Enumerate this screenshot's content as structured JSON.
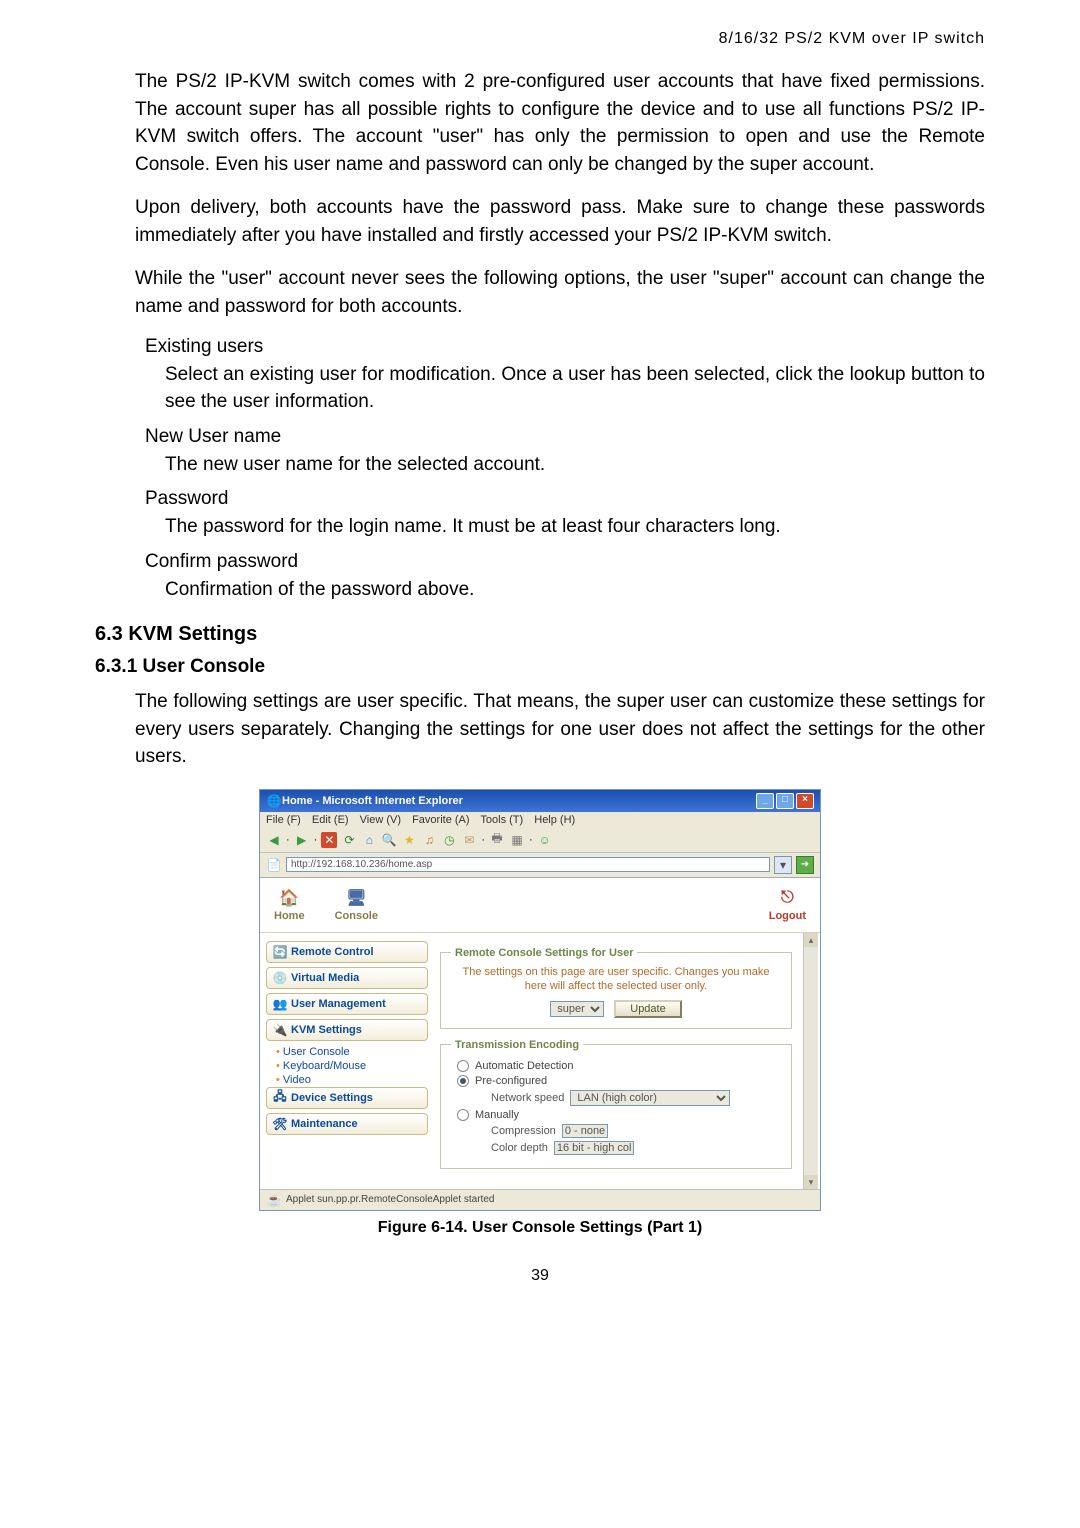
{
  "header": "8/16/32 PS/2 KVM over IP switch",
  "para1": "The PS/2 IP-KVM switch comes with 2 pre-configured user accounts that have fixed permissions. The account super has all possible rights to configure the device and to use all functions PS/2 IP-KVM switch offers. The account \"user\" has only the permission to open and use the Remote Console. Even his user name and password can only be changed by the super account.",
  "para2": "Upon delivery, both accounts have the password pass. Make sure to change these passwords immediately after you have installed and firstly accessed your PS/2 IP-KVM switch.",
  "para3": "While the \"user\" account never sees the following options, the user \"super\" account can change the name and password for both accounts.",
  "terms": {
    "t1": "Existing users",
    "d1": "Select an existing user for modification. Once a user has been selected, click the lookup button to see the user information.",
    "t2": "New User name",
    "d2": "The new user name for the selected account.",
    "t3": "Password",
    "d3": "The password for the login name. It must be at least four characters long.",
    "t4": "Confirm password",
    "d4": "Confirmation of the password above."
  },
  "sec": "6.3 KVM Settings",
  "subsec": "6.3.1  User Console",
  "para4": "The following settings are user specific. That means, the super user can customize these settings for every users separately. Changing the settings for one user does not affect the settings for the other users.",
  "shot": {
    "title": "Home - Microsoft Internet Explorer",
    "menu": {
      "file": "File (F)",
      "edit": "Edit (E)",
      "view": "View (V)",
      "fav": "Favorite (A)",
      "tools": "Tools (T)",
      "help": "Help (H)"
    },
    "address": "http://192.168.10.236/home.asp",
    "topnav": {
      "home": "Home",
      "console": "Console",
      "logout": "Logout"
    },
    "sidebar": {
      "remote": "Remote Control",
      "virtual": "Virtual Media",
      "usermgmt": "User Management",
      "kvm": "KVM Settings",
      "sub_user": "User Console",
      "sub_kb": "Keyboard/Mouse",
      "sub_video": "Video",
      "device": "Device Settings",
      "maint": "Maintenance"
    },
    "panel1": {
      "legend": "Remote Console Settings for User",
      "desc": "The settings on this page are user specific. Changes you make here will affect the selected user only.",
      "user_select": "super",
      "update_btn": "Update"
    },
    "panel2": {
      "legend": "Transmission Encoding",
      "opt_auto": "Automatic Detection",
      "opt_pre": "Pre-configured",
      "net_label": "Network speed",
      "net_value": "LAN (high color)",
      "opt_manual": "Manually",
      "comp_label": "Compression",
      "comp_value": "0 - none",
      "depth_label": "Color depth",
      "depth_value": "16 bit - high col"
    },
    "status": "Applet sun.pp.pr.RemoteConsoleApplet started"
  },
  "caption": "Figure 6-14. User Console Settings (Part 1)",
  "pagenum": "39"
}
